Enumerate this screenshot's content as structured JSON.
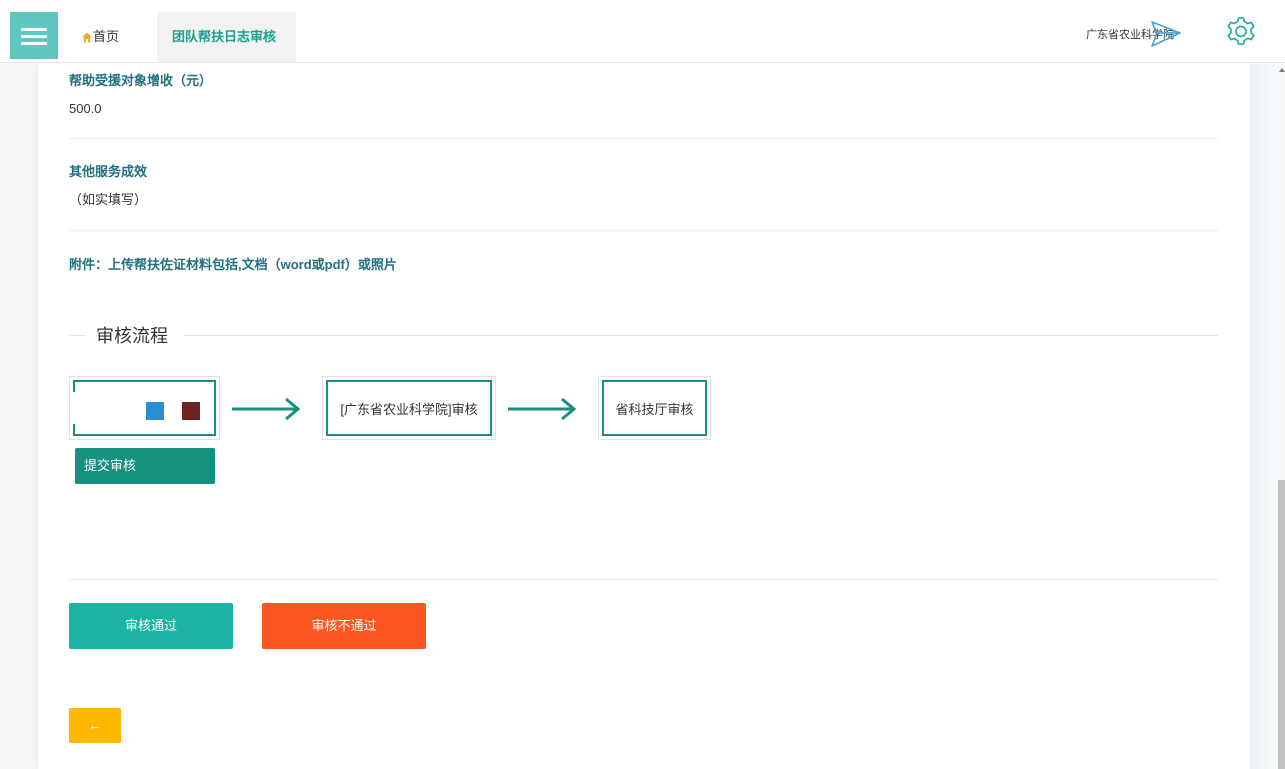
{
  "header": {
    "menu_icon": "hamburger-icon",
    "tabs": [
      {
        "label": "首页",
        "icon": "home-icon"
      },
      {
        "label": "团队帮扶日志审核",
        "active": true
      }
    ],
    "org_name": "广东省农业科学院",
    "send_icon": "paper-plane-icon",
    "settings_icon": "gear-icon"
  },
  "fields": [
    {
      "label": "帮助受援对象增收（元）",
      "value": "500.0"
    },
    {
      "label": "其他服务成效",
      "value": "（如实填写）"
    },
    {
      "label": "附件：上传帮扶佐证材料包括,文档（word或pdf）或照片"
    }
  ],
  "flow": {
    "title": "审核流程",
    "steps": [
      {
        "label": "",
        "tag": "提交审核"
      },
      {
        "label": "[广东省农业科学院]审核"
      },
      {
        "label": "省科技厅审核"
      }
    ]
  },
  "actions": {
    "approve": "审核通过",
    "reject": "审核不通过",
    "back": "←"
  },
  "colors": {
    "accent": "#1aa08f",
    "label": "#21707f",
    "flow_border": "#1a8f80",
    "approve": "#1bb3a3",
    "reject": "#ff5722",
    "back": "#ffb800",
    "step_image_blue": "#2a8fd0",
    "step_image_maroon": "#6e2222"
  }
}
